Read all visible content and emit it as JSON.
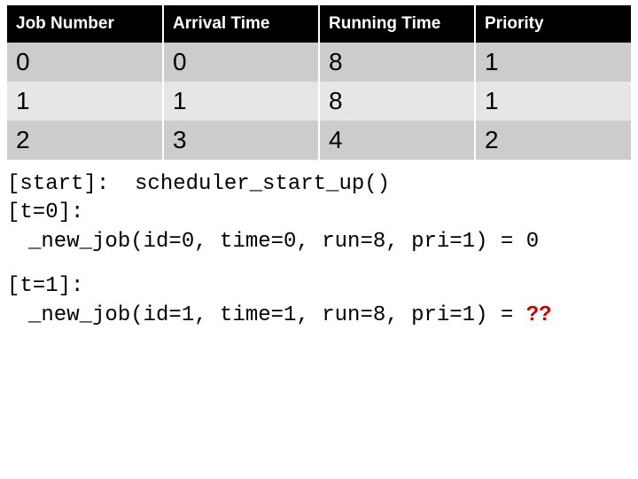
{
  "table": {
    "headers": [
      "Job Number",
      "Arrival Time",
      "Running Time",
      "Priority"
    ],
    "rows": [
      {
        "job": "0",
        "arrival": "0",
        "run": "8",
        "pri": "1"
      },
      {
        "job": "1",
        "arrival": "1",
        "run": "8",
        "pri": "1"
      },
      {
        "job": "2",
        "arrival": "3",
        "run": "4",
        "pri": "2"
      }
    ]
  },
  "log": {
    "block1": {
      "line1": "[start]:  scheduler_start_up()",
      "line2": "[t=0]:",
      "line3": "_new_job(id=0, time=0, run=8, pri=1) = 0"
    },
    "block2": {
      "line1": "[t=1]:",
      "line2a": "_new_job(id=1, time=1, run=8, pri=1) = ",
      "line2b": "??"
    }
  }
}
